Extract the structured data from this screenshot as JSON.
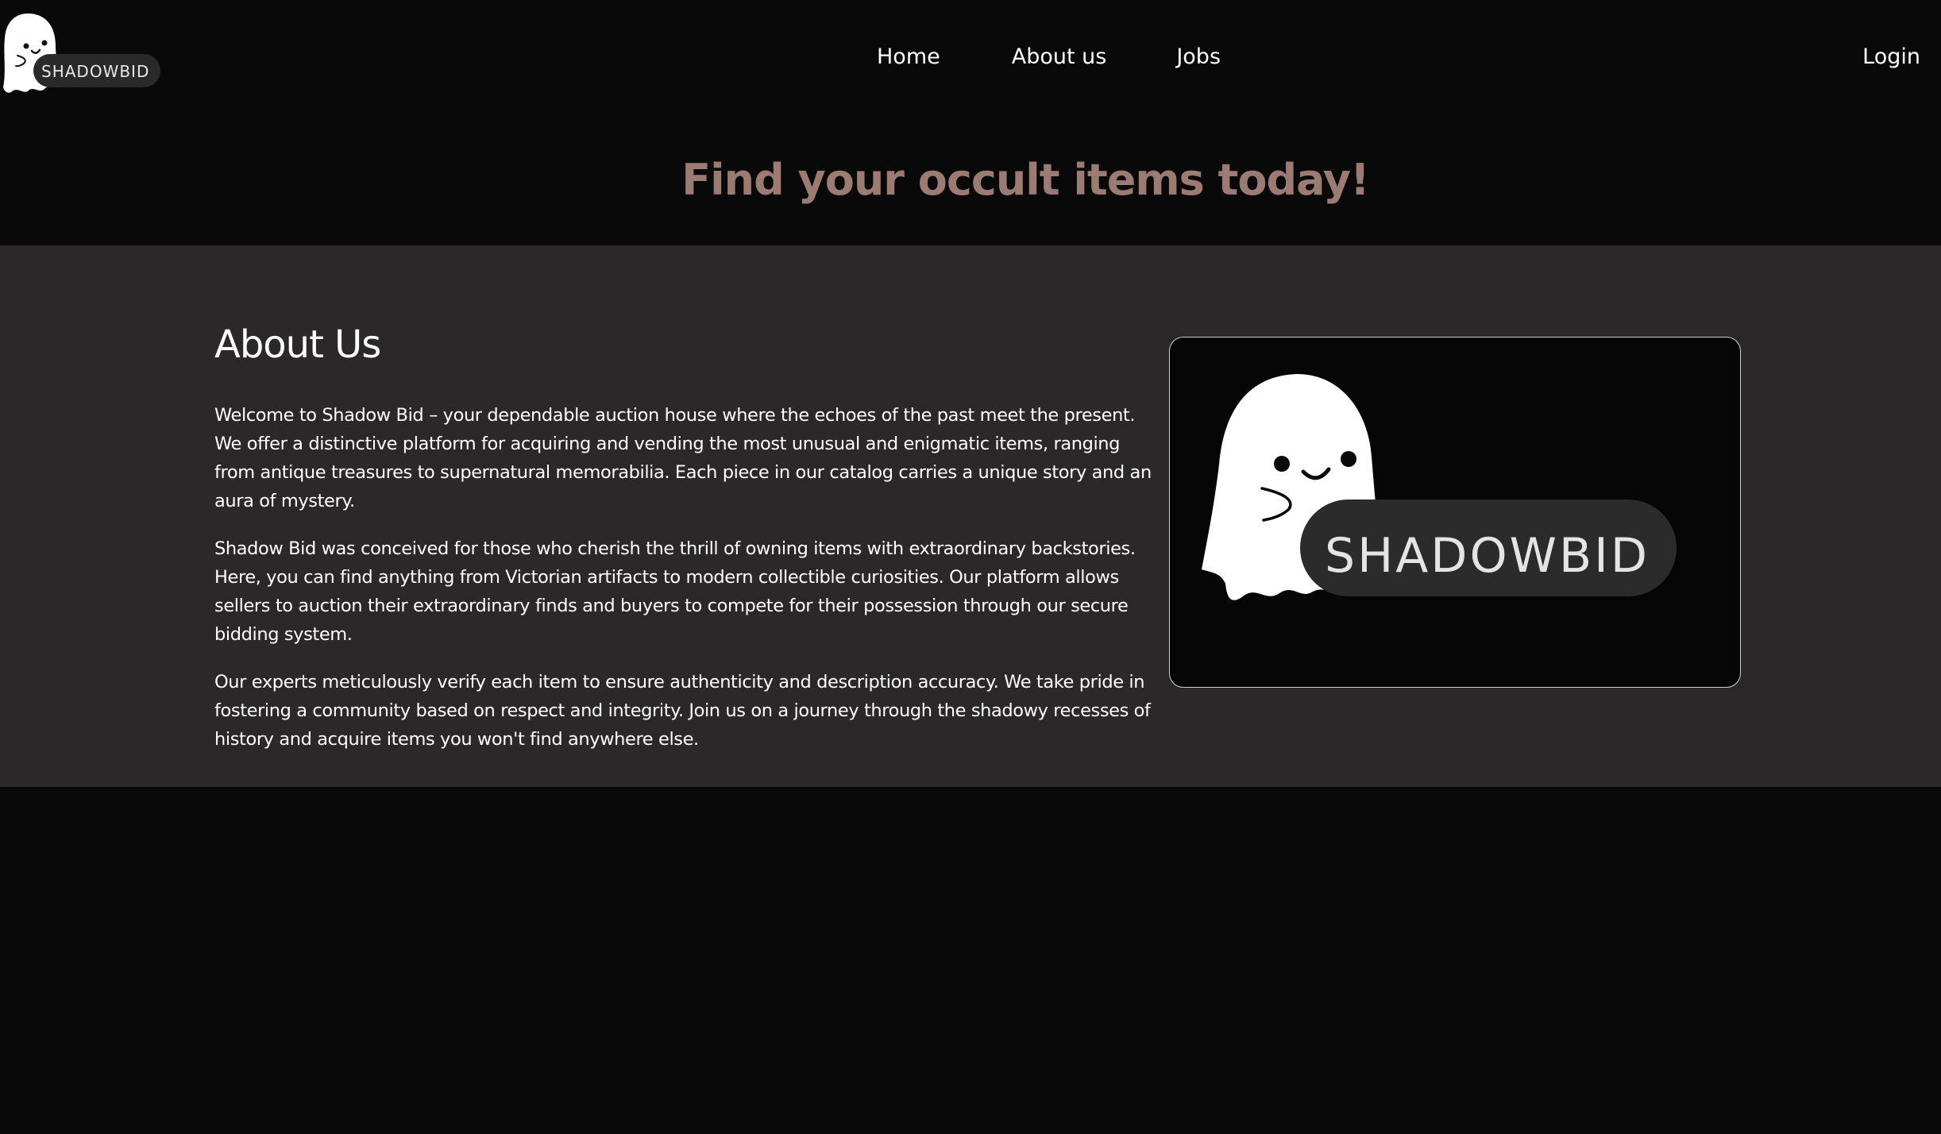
{
  "brand": {
    "name": "SHADOWBID",
    "colors": {
      "background": "#0a0909",
      "section": "#2a2829",
      "hero_accent": "#9c7c72",
      "text": "#ffffff"
    }
  },
  "nav": {
    "links": [
      {
        "label": "Home"
      },
      {
        "label": "About us"
      },
      {
        "label": "Jobs"
      }
    ],
    "login_label": "Login"
  },
  "hero": {
    "title": "Find your occult items today!"
  },
  "about": {
    "heading": "About Us",
    "paragraphs": [
      "Welcome to Shadow Bid – your dependable auction house where the echoes of the past meet the present. We offer a distinctive platform for acquiring and vending the most unusual and enigmatic items, ranging from antique treasures to supernatural memorabilia. Each piece in our catalog carries a unique story and an aura of mystery.",
      "Shadow Bid was conceived for those who cherish the thrill of owning items with extraordinary backstories. Here, you can find anything from Victorian artifacts to modern collectible curiosities. Our platform allows sellers to auction their extraordinary finds and buyers to compete for their possession through our secure bidding system.",
      "Our experts meticulously verify each item to ensure authenticity and description accuracy. We take pride in fostering a community based on respect and integrity. Join us on a journey through the shadowy recesses of history and acquire items you won't find anywhere else."
    ],
    "image_brand": "SHADOWBID"
  },
  "icons": {
    "logo": "ghost-logo-icon",
    "card": "ghost-illustration-icon"
  }
}
